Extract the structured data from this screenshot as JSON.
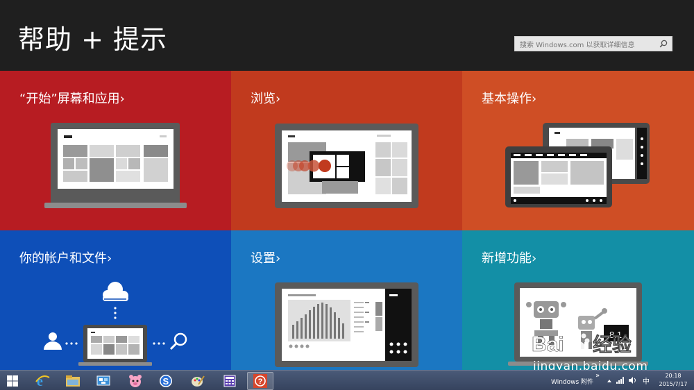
{
  "header": {
    "title": "帮助 + 提示",
    "search_placeholder": "搜索 Windows.com 以获取详细信息"
  },
  "tiles": [
    {
      "label": "“开始”屏幕和应用›",
      "color": "#b71c22"
    },
    {
      "label": "浏览›",
      "color": "#c13a1e"
    },
    {
      "label": "基本操作›",
      "color": "#cf4e25"
    },
    {
      "label": "你的帐户和文件›",
      "color": "#0e4fb8"
    },
    {
      "label": "设置›",
      "color": "#1b77c2"
    },
    {
      "label": "新增功能›",
      "color": "#138fa6"
    }
  ],
  "illustration_text": {
    "version": "8.1"
  },
  "watermark": {
    "brand": "Bai",
    "brand2": "经验",
    "url": "jingyan.baidu.com"
  },
  "taskbar": {
    "apps": [
      "start-icon",
      "ie-icon",
      "file-explorer-icon",
      "network-icon",
      "pig-app-icon",
      "sogou-icon",
      "paint-icon",
      "calculator-icon",
      "help-app-icon"
    ],
    "tray_label": "Windows 附件",
    "tray_chevron": "»",
    "ime": "中",
    "time": "20:18",
    "date": "2015/7/17"
  }
}
